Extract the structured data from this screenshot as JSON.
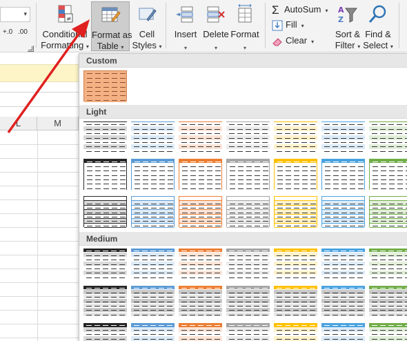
{
  "ribbon": {
    "decimal_increase": ".00",
    "decimal_increase_sub": "+.0",
    "decimal_decrease": ".00",
    "decimal_decrease_sub": "→.0",
    "conditional_formatting": {
      "line1": "Conditional",
      "line2": "Formatting"
    },
    "format_as_table": {
      "line1": "Format as",
      "line2": "Table"
    },
    "cell_styles": {
      "line1": "Cell",
      "line2": "Styles"
    },
    "insert": "Insert",
    "delete": "Delete",
    "format": "Format",
    "autosum": "AutoSum",
    "fill": "Fill",
    "clear": "Clear",
    "sort_filter": {
      "line1": "Sort &",
      "line2": "Filter"
    },
    "find_select": {
      "line1": "Find &",
      "line2": "Select"
    },
    "dropdown_glyph": "▾"
  },
  "sheet": {
    "columns": [
      "L",
      "M"
    ]
  },
  "gallery": {
    "sections": [
      "Custom",
      "Light",
      "Medium"
    ]
  },
  "colors": {
    "accent_orange": "#f4b183",
    "annotation_arrow": "#e02020",
    "black": "#262626",
    "blue": "#5b9bd5",
    "orange": "#ed7d31",
    "gray": "#a5a5a5",
    "gold": "#ffc000",
    "lightblue": "#4aa3df",
    "green": "#70ad47"
  }
}
